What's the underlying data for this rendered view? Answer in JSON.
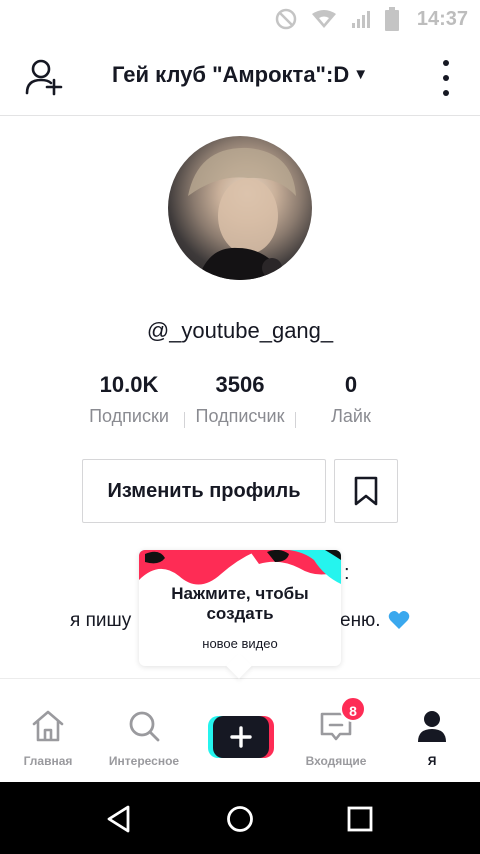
{
  "status_bar": {
    "time": "14:37"
  },
  "header": {
    "title": "Гей клуб \"Амрокта\":D"
  },
  "profile": {
    "username": "@_youtube_gang_",
    "stats": [
      {
        "value": "10.0K",
        "label": "Подписки"
      },
      {
        "value": "3506",
        "label": "Подписчик"
      },
      {
        "value": "0",
        "label": "Лайк"
      }
    ],
    "edit_label": "Изменить профиль",
    "bio_line_1_tail": ":",
    "bio_line_2_head": "я пишу",
    "bio_line_2_tail": "еню."
  },
  "tooltip": {
    "title": "Нажмите, чтобы создать",
    "subtitle": "новое видео"
  },
  "tabs": [
    {
      "label": "Главная",
      "icon": "home-icon"
    },
    {
      "label": "Интересное",
      "icon": "search-icon"
    },
    {
      "label": "",
      "icon": "plus-icon"
    },
    {
      "label": "Входящие",
      "icon": "inbox-icon",
      "badge": "8"
    },
    {
      "label": "Я",
      "icon": "person-icon",
      "active": true
    }
  ],
  "colors": {
    "accent_red": "#fe2c55",
    "accent_cyan": "#25f4ee",
    "heart_blue": "#3aa8ee"
  }
}
